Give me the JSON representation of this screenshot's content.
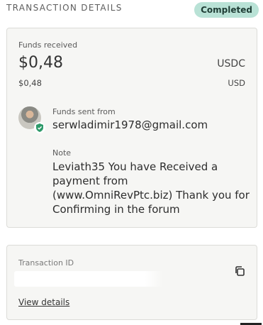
{
  "header": {
    "title": "TRANSACTION DETAILS",
    "status": "Completed"
  },
  "funds": {
    "label": "Funds received",
    "amount": "$0,48",
    "currency": "USDC",
    "amount_secondary": "$0,48",
    "currency_secondary": "USD"
  },
  "sender": {
    "label": "Funds sent from",
    "email": "serwladimir1978@gmail.com"
  },
  "note": {
    "label": "Note",
    "text": "Leviath35 You have Received a payment from (www.OmniRevPtc.biz) Thank you for Confirming in the forum"
  },
  "transaction": {
    "label": "Transaction ID",
    "link": "View details"
  },
  "colors": {
    "badge_bg": "#b9e2d6",
    "shield": "#2f9a6a"
  }
}
